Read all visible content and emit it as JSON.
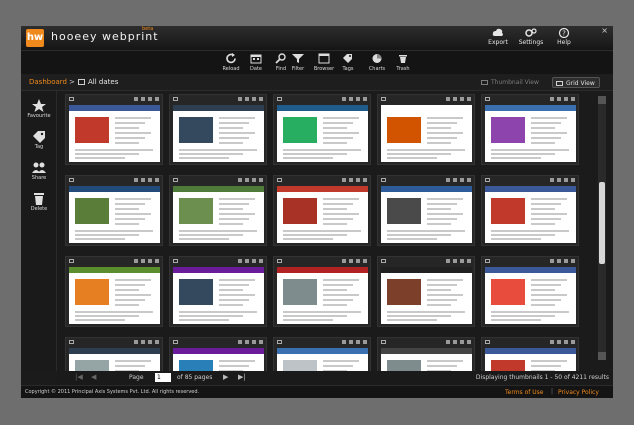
{
  "app": {
    "logo": "hw",
    "title": "hooeey webprint",
    "beta": "beta"
  },
  "header_actions": [
    {
      "id": "export",
      "label": "Export",
      "icon": "cloud-export-icon"
    },
    {
      "id": "settings",
      "label": "Settings",
      "icon": "gears-icon"
    },
    {
      "id": "help",
      "label": "Help",
      "icon": "help-icon"
    }
  ],
  "toolbar": [
    {
      "id": "reload",
      "label": "Reload",
      "icon": "reload-icon"
    },
    {
      "id": "date",
      "label": "Date",
      "icon": "calendar-icon"
    },
    {
      "id": "find",
      "label": "Find",
      "icon": "magnifier-icon"
    },
    {
      "id": "filter",
      "label": "Filter",
      "icon": "funnel-icon"
    },
    {
      "id": "browser",
      "label": "Browser",
      "icon": "browser-icon"
    },
    {
      "id": "tags",
      "label": "Tags",
      "icon": "tags-icon"
    },
    {
      "id": "charts",
      "label": "Charts",
      "icon": "pie-chart-icon"
    },
    {
      "id": "trash",
      "label": "Trash",
      "icon": "trash-icon"
    }
  ],
  "breadcrumb": {
    "home": "Dashboard",
    "separator": ">",
    "current": "All dates"
  },
  "views": {
    "thumbnail": "Thumbnail View",
    "grid": "Grid View",
    "active": "grid"
  },
  "sidebar": [
    {
      "id": "favourite",
      "label": "Favourite",
      "icon": "star-icon"
    },
    {
      "id": "tag",
      "label": "Tag",
      "icon": "tag-icon"
    },
    {
      "id": "share",
      "label": "Share",
      "icon": "people-icon"
    },
    {
      "id": "delete",
      "label": "Delete",
      "icon": "trash-icon"
    }
  ],
  "thumbnails": [
    {
      "accent": "#3b5998",
      "block": "#c0392b"
    },
    {
      "accent": "#2c3e50",
      "block": "#34495e"
    },
    {
      "accent": "#1f5c8b",
      "block": "#27ae60"
    },
    {
      "accent": "#ffffff",
      "block": "#d35400"
    },
    {
      "accent": "#3a6fb0",
      "block": "#8e44ad"
    },
    {
      "accent": "#224a7a",
      "block": "#5a7d3a"
    },
    {
      "accent": "#4e7a3a",
      "block": "#6c8f4f"
    },
    {
      "accent": "#c0392b",
      "block": "#a93226"
    },
    {
      "accent": "#2e5c9a",
      "block": "#4a4a4a"
    },
    {
      "accent": "#3b5998",
      "block": "#c0392b"
    },
    {
      "accent": "#5b8f2d",
      "block": "#e67e22"
    },
    {
      "accent": "#6a1b9a",
      "block": "#34495e"
    },
    {
      "accent": "#b22222",
      "block": "#7f8c8d"
    },
    {
      "accent": "#202020",
      "block": "#7b3f2a"
    },
    {
      "accent": "#3b5998",
      "block": "#e74c3c"
    },
    {
      "accent": "#2c3e50",
      "block": "#95a5a6"
    },
    {
      "accent": "#6a1b9a",
      "block": "#2980b9"
    },
    {
      "accent": "#3a6fb0",
      "block": "#bdc3c7"
    },
    {
      "accent": "#444444",
      "block": "#7f8c8d"
    },
    {
      "accent": "#3b5998",
      "block": "#c0392b"
    }
  ],
  "pager": {
    "page_label": "Page",
    "page_value": "1",
    "of_label": "of 85 pages",
    "status": "Displaying thumbnails 1 - 50 of 4211 results"
  },
  "footer": {
    "copyright": "Copyright © 2011 Principal Axis Systems Pvt. Ltd. All rights reserved.",
    "terms": "Terms of Use",
    "separator": "|",
    "privacy": "Privacy Policy"
  },
  "colors": {
    "brand_orange": "#f08a1c",
    "frame": "#1b1b1b",
    "backdrop": "#6e6e6e"
  }
}
